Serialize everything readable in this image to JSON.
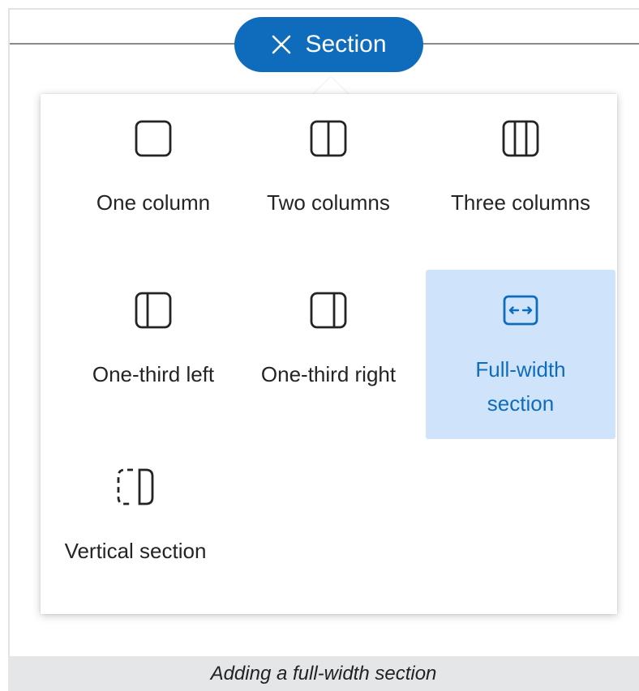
{
  "header": {
    "pill_label": "Section",
    "close_icon": "close-icon"
  },
  "options": [
    {
      "label": "One column",
      "icon": "one-column-icon",
      "selected": false
    },
    {
      "label": "Two columns",
      "icon": "two-columns-icon",
      "selected": false
    },
    {
      "label": "Three columns",
      "icon": "three-columns-icon",
      "selected": false
    },
    {
      "label": "One-third left",
      "icon": "one-third-left-icon",
      "selected": false
    },
    {
      "label": "One-third right",
      "icon": "one-third-right-icon",
      "selected": false
    },
    {
      "label": "Full-width\nsection",
      "icon": "full-width-icon",
      "selected": true
    },
    {
      "label": "Vertical section",
      "icon": "vertical-section-icon",
      "selected": false
    }
  ],
  "caption": "Adding a full-width section",
  "colors": {
    "accent": "#0f6cbd",
    "selected_bg": "#cfe4fa",
    "caption_bg": "#e5e6e8"
  }
}
